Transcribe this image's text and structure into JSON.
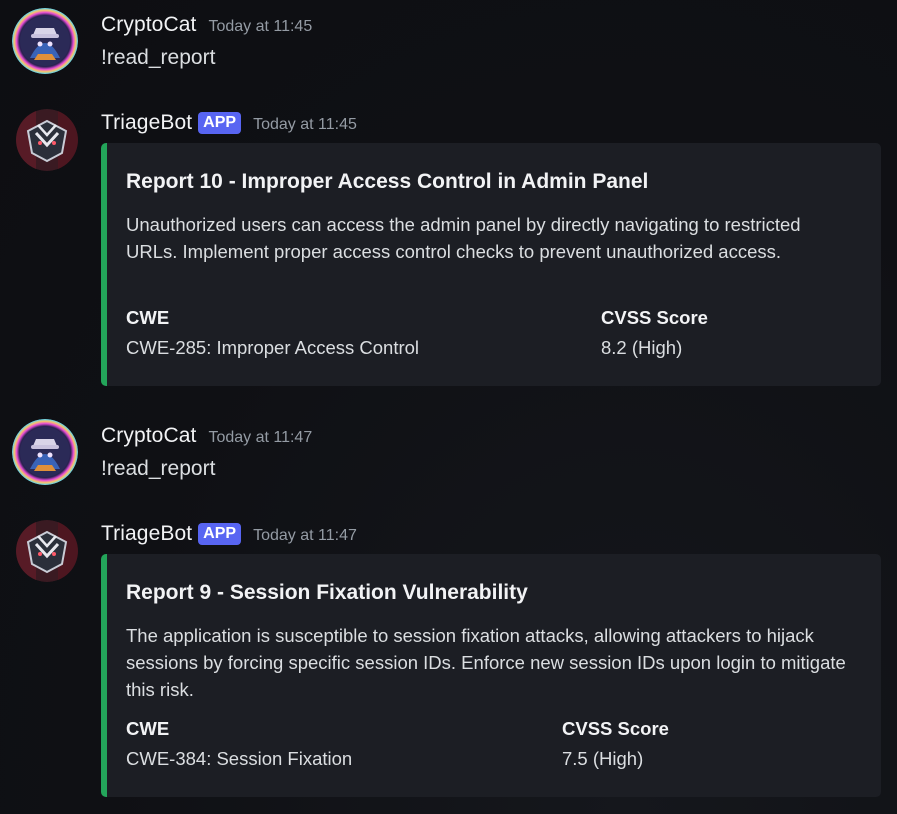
{
  "messages": [
    {
      "username": "CryptoCat",
      "timestamp": "Today at 11:45",
      "text": "!read_report"
    },
    {
      "username": "TriageBot",
      "badge": "APP",
      "timestamp": "Today at 11:45",
      "embed": {
        "accent_color": "#23a55a",
        "title": "Report 10 - Improper Access Control in Admin Panel",
        "description": "Unauthorized users can access the admin panel by directly navigating to restricted URLs. Implement proper access control checks to prevent unauthorized access.",
        "fields": [
          {
            "name": "CWE",
            "value": "CWE-285: Improper Access Control"
          },
          {
            "name": "CVSS Score",
            "value": "8.2 (High)"
          }
        ]
      }
    },
    {
      "username": "CryptoCat",
      "timestamp": "Today at 11:47",
      "text": "!read_report"
    },
    {
      "username": "TriageBot",
      "badge": "APP",
      "timestamp": "Today at 11:47",
      "embed": {
        "accent_color": "#23a55a",
        "title": "Report 9 - Session Fixation Vulnerability",
        "description": "The application is susceptible to session fixation attacks, allowing attackers to hijack sessions by forcing specific session IDs. Enforce new session IDs upon login to mitigate this risk.",
        "fields": [
          {
            "name": "CWE",
            "value": "CWE-384: Session Fixation"
          },
          {
            "name": "CVSS Score",
            "value": "7.5 (High)"
          }
        ]
      }
    }
  ],
  "icons": {
    "user_avatar": "cat-avatar-icon",
    "bot_avatar": "triagebot-avatar-icon"
  },
  "colors": {
    "badge": "#5865f2",
    "embed_accent": "#23a55a",
    "embed_bg": "#1c1e24"
  }
}
